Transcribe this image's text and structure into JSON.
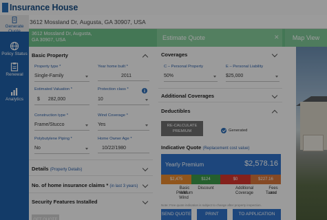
{
  "app": {
    "logo_text": "Insurance House"
  },
  "address_bar": {
    "address": "3612 Mossland Dr, Augusta, GA 30907, USA"
  },
  "sidebar": {
    "items": [
      {
        "label": "Generate Quote",
        "icon": "document-icon",
        "active": true
      },
      {
        "label": "Policy Status",
        "icon": "globe-icon",
        "active": false
      },
      {
        "label": "Renewal",
        "icon": "clipboard-icon",
        "active": false
      },
      {
        "label": "Analytics",
        "icon": "chart-icon",
        "active": false
      }
    ]
  },
  "green_bar": {
    "address_line1": "3612 Mossland Dr, Augusta,",
    "address_line2": "GA 30907, USA",
    "estimate_label": "Estimate Quote",
    "map_label": "Map View"
  },
  "basic_property": {
    "title": "Basic Property",
    "fields": {
      "property_type": {
        "label": "Property type *",
        "value": "Single-Family"
      },
      "year_built": {
        "label": "Year home built *",
        "value": "2011"
      },
      "valuation": {
        "label": "Estimated Valuation *",
        "prefix": "$",
        "value": "282,000"
      },
      "protection_class": {
        "label": "Protection class *",
        "value": "10"
      },
      "construction_type": {
        "label": "Construction type *",
        "value": "Frame/Stucco"
      },
      "wind_coverage": {
        "label": "Wind Coverage *",
        "value": "Yes"
      },
      "polybutylene": {
        "label": "Polybutylene Piping *",
        "value": "No"
      },
      "owner_age": {
        "label": "Home Owner Age *",
        "value": "10/22/1980"
      }
    }
  },
  "sections": {
    "details": {
      "label": "Details",
      "sub": "(Property Details)"
    },
    "claims": {
      "label": "No. of home insurance claims *",
      "sub": "(in last 3 years)"
    },
    "security": {
      "label": "Security Features Installed"
    }
  },
  "get_quote_button": "GET QUOTE",
  "coverages": {
    "title": "Coverages",
    "personal_property": {
      "label": "C – Personal Property",
      "value": "50%"
    },
    "personal_liability": {
      "label": "E – Personal Liability",
      "value": "$25,000"
    },
    "additional_title": "Additional Coverages",
    "deductibles_title": "Deductibles",
    "recalculate_line1": "RE-CALCULATE",
    "recalculate_line2": "PREMIUM",
    "generated_label": "Generated"
  },
  "indicative_quote": {
    "title": "Indicative Quote",
    "subtitle": "(Replacement cost value)",
    "yearly_label": "Yearly Premium",
    "yearly_value": "$2,578.16",
    "breakdown": [
      {
        "value": "$2,475",
        "label_line1": "Basic Premium",
        "label_line2": "With Wind",
        "color": "#e98a2e"
      },
      {
        "value": "$124",
        "label_line1": "Discount",
        "label_line2": "",
        "color": "#3d9a4a"
      },
      {
        "value": "$0",
        "label_line1": "Additional",
        "label_line2": "Coverage",
        "color": "#d5362e"
      },
      {
        "value": "$227.16",
        "label_line1": "Fees and",
        "label_line2": "Taxes",
        "color": "#d7773a"
      }
    ],
    "note": "Note: Free quote indication is subject to change after property inspection.",
    "buttons": [
      "SEND QUOTE",
      "PRINT",
      "TO APPLICATION"
    ]
  },
  "colors": {
    "brand_blue": "#1f5fa8",
    "accent_green": "#6fc08a",
    "label_blue": "#2b5ea7"
  }
}
